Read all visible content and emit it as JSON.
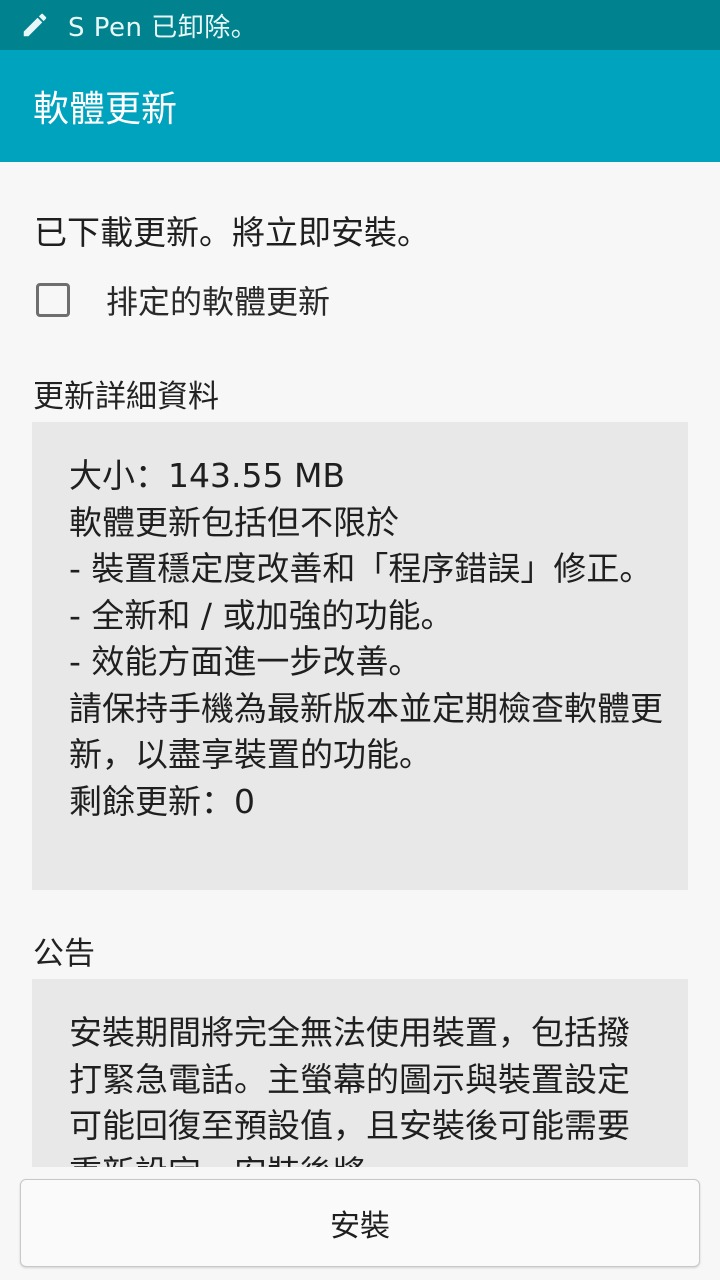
{
  "status_bar": {
    "text": "S Pen 已卸除。",
    "icon": "pen-icon"
  },
  "app_bar": {
    "title": "軟體更新"
  },
  "main": {
    "downloaded_message": "已下載更新。將立即安裝。",
    "schedule_checkbox": {
      "label": "排定的軟體更新",
      "checked": false
    },
    "details": {
      "heading": "更新詳細資料",
      "body": "大小：143.55 MB\n軟體更新包括但不限於\n - 裝置穩定度改善和「程序錯誤」修正。\n - 全新和 / 或加強的功能。\n - 效能方面進一步改善。\n請保持手機為最新版本並定期檢查軟體更新，以盡享裝置的功能。\n剩餘更新：0"
    },
    "notice": {
      "heading": "公告",
      "body": "安裝期間將完全無法使用裝置，包括撥打緊急電話。主螢幕的圖示與裝置設定可能回復至預設值，且安裝後可能需要重新設定。安裝後將"
    }
  },
  "footer": {
    "install_label": "安裝"
  },
  "colors": {
    "status_bar": "#00838f",
    "app_bar": "#00a3bd",
    "background": "#f7f7f7",
    "box": "#e8e8e8"
  }
}
